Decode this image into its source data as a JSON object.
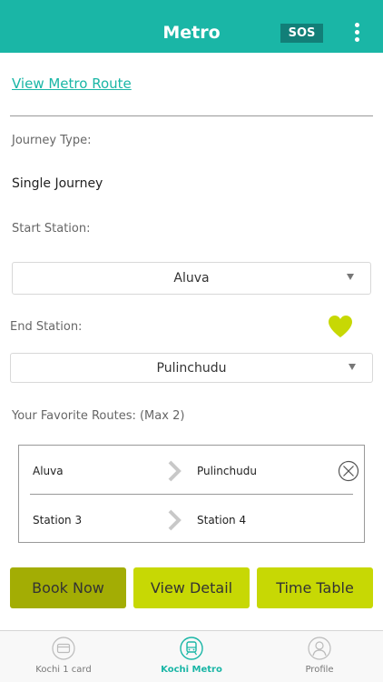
{
  "header": {
    "title": "Metro",
    "sos_label": "SOS"
  },
  "route_link": "View Metro Route",
  "journey": {
    "type_label": "Journey Type:",
    "type_value": "Single Journey"
  },
  "start_station": {
    "label": "Start Station:",
    "selected": "Aluva"
  },
  "end_station": {
    "label": "End Station:",
    "selected": "Pulinchudu"
  },
  "favorites": {
    "label": "Your Favorite Routes: (Max 2)",
    "routes": [
      {
        "from": "Aluva",
        "to": "Pulinchudu"
      },
      {
        "from": "Station 3",
        "to": "Station 4"
      }
    ]
  },
  "buttons": {
    "book": "Book Now",
    "detail": "View Detail",
    "timetable": "Time Table"
  },
  "nav": [
    {
      "label": "Kochi 1 card",
      "icon": "card-icon"
    },
    {
      "label": "Kochi Metro",
      "icon": "metro-train-icon",
      "active": true
    },
    {
      "label": "Profile",
      "icon": "profile-icon"
    }
  ],
  "colors": {
    "accent": "#1ab6a6",
    "lime": "#c7d804",
    "lime_dark": "#a3ad04",
    "sos_bg": "#127f78"
  }
}
